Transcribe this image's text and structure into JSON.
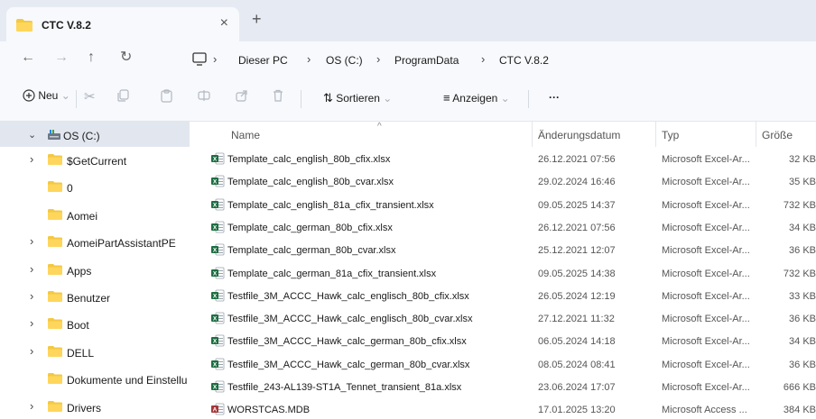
{
  "window": {
    "tab_title": "CTC V.8.2",
    "tab_close": "×",
    "new_tab": "+"
  },
  "navigation": {
    "back": "←",
    "forward": "→",
    "up": "↑",
    "refresh": "↻"
  },
  "breadcrumb": {
    "separator": "›",
    "items": [
      "Dieser PC",
      "OS (C:)",
      "ProgramData",
      "CTC V.8.2"
    ]
  },
  "toolbar": {
    "new_label": "Neu",
    "sort_label": "Sortieren",
    "view_label": "Anzeigen",
    "more_label": "···"
  },
  "sidebar": {
    "root_label": "OS (C:)",
    "items": [
      {
        "label": "$GetCurrent",
        "expandable": true
      },
      {
        "label": "0",
        "expandable": false
      },
      {
        "label": "Aomei",
        "expandable": false
      },
      {
        "label": "AomeiPartAssistantPE",
        "expandable": true
      },
      {
        "label": "Apps",
        "expandable": true
      },
      {
        "label": "Benutzer",
        "expandable": true
      },
      {
        "label": "Boot",
        "expandable": true
      },
      {
        "label": "DELL",
        "expandable": true
      },
      {
        "label": "Dokumente und Einstellu",
        "expandable": false
      },
      {
        "label": "Drivers",
        "expandable": true
      }
    ]
  },
  "columns": {
    "name": "Name",
    "date": "Änderungsdatum",
    "type": "Typ",
    "size": "Größe"
  },
  "files": [
    {
      "name": "Template_calc_english_80b_cfix.xlsx",
      "date": "26.12.2021 07:56",
      "type": "Microsoft Excel-Ar...",
      "size": "32 KB",
      "icon": "excel-icon"
    },
    {
      "name": "Template_calc_english_80b_cvar.xlsx",
      "date": "29.02.2024 16:46",
      "type": "Microsoft Excel-Ar...",
      "size": "35 KB",
      "icon": "excel-icon"
    },
    {
      "name": "Template_calc_english_81a_cfix_transient.xlsx",
      "date": "09.05.2025 14:37",
      "type": "Microsoft Excel-Ar...",
      "size": "732 KB",
      "icon": "excel-icon"
    },
    {
      "name": "Template_calc_german_80b_cfix.xlsx",
      "date": "26.12.2021 07:56",
      "type": "Microsoft Excel-Ar...",
      "size": "34 KB",
      "icon": "excel-icon"
    },
    {
      "name": "Template_calc_german_80b_cvar.xlsx",
      "date": "25.12.2021 12:07",
      "type": "Microsoft Excel-Ar...",
      "size": "36 KB",
      "icon": "excel-icon"
    },
    {
      "name": "Template_calc_german_81a_cfix_transient.xlsx",
      "date": "09.05.2025 14:38",
      "type": "Microsoft Excel-Ar...",
      "size": "732 KB",
      "icon": "excel-icon"
    },
    {
      "name": "Testfile_3M_ACCC_Hawk_calc_englisch_80b_cfix.xlsx",
      "date": "26.05.2024 12:19",
      "type": "Microsoft Excel-Ar...",
      "size": "33 KB",
      "icon": "excel-icon"
    },
    {
      "name": "Testfile_3M_ACCC_Hawk_calc_englisch_80b_cvar.xlsx",
      "date": "27.12.2021 11:32",
      "type": "Microsoft Excel-Ar...",
      "size": "36 KB",
      "icon": "excel-icon"
    },
    {
      "name": "Testfile_3M_ACCC_Hawk_calc_german_80b_cfix.xlsx",
      "date": "06.05.2024 14:18",
      "type": "Microsoft Excel-Ar...",
      "size": "34 KB",
      "icon": "excel-icon"
    },
    {
      "name": "Testfile_3M_ACCC_Hawk_calc_german_80b_cvar.xlsx",
      "date": "08.05.2024 08:41",
      "type": "Microsoft Excel-Ar...",
      "size": "36 KB",
      "icon": "excel-icon"
    },
    {
      "name": "Testfile_243-AL139-ST1A_Tennet_transient_81a.xlsx",
      "date": "23.06.2024 17:07",
      "type": "Microsoft Excel-Ar...",
      "size": "666 KB",
      "icon": "excel-icon"
    },
    {
      "name": "WORSTCAS.MDB",
      "date": "17.01.2025 13:20",
      "type": "Microsoft Access ...",
      "size": "384 KB",
      "icon": "access-icon"
    }
  ],
  "colors": {
    "tabstrip_bg": "#e6ebf3",
    "folder_yellow": "#f4c842",
    "excel_green": "#1d6f42",
    "access_red": "#a4373a",
    "selection_bg": "#e2e7ef"
  }
}
